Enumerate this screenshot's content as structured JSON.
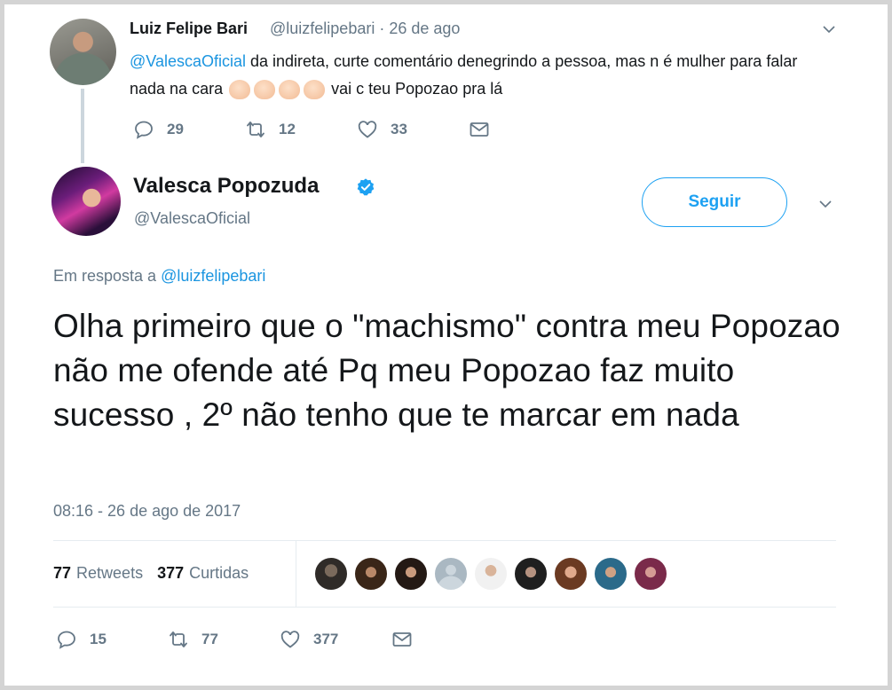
{
  "reply_tweet": {
    "author_name": "Luiz Felipe Bari",
    "author_handle": "@luizfelipebari",
    "separator": "·",
    "date": "26 de ago",
    "mention": "@ValescaOficial",
    "text_part1": " da indireta, curte comentário denegrindo a pessoa, mas n é mulher para falar nada na cara ",
    "emoji_name": "clapping-hands",
    "emoji_count": 4,
    "text_part2": " vai c teu Popozao pra lá",
    "replies": "29",
    "retweets": "12",
    "likes": "33"
  },
  "main_tweet": {
    "author_name": "Valesca Popozuda",
    "verified": true,
    "author_handle": "@ValescaOficial",
    "follow_label": "Seguir",
    "reply_prefix": "Em resposta a",
    "reply_mention": "@luizfelipebari",
    "text": "Olha primeiro que o \"machismo\" contra meu Popozao não me ofende até Pq meu Popozao faz muito sucesso , 2º não tenho que te marcar em nada",
    "timestamp": "08:16 - 26 de ago de 2017",
    "retweet_count": "77",
    "retweet_label": "Retweets",
    "like_count": "377",
    "like_label": "Curtidas",
    "likers_count": 9,
    "replies": "15",
    "retweets": "77",
    "likes": "377"
  },
  "colors": {
    "accent": "#1da1f2",
    "link": "#1b95e0",
    "muted": "#657786",
    "text": "#14171a",
    "divider": "#e6ecf0"
  },
  "icons": [
    "reply-icon",
    "retweet-icon",
    "like-icon",
    "direct-message-icon",
    "chevron-down-icon",
    "verified-badge-icon"
  ]
}
